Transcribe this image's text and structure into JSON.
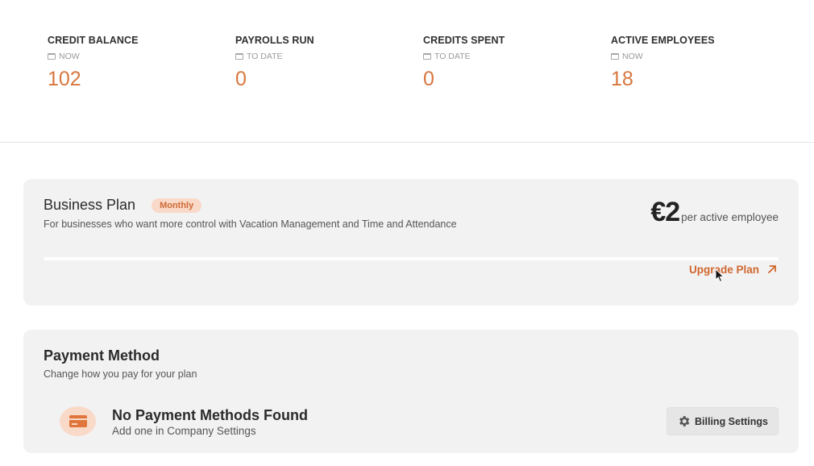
{
  "stats": [
    {
      "label": "CREDIT BALANCE",
      "sub": "NOW",
      "value": "102"
    },
    {
      "label": "PAYROLLS RUN",
      "sub": "TO DATE",
      "value": "0"
    },
    {
      "label": "CREDITS SPENT",
      "sub": "TO DATE",
      "value": "0"
    },
    {
      "label": "ACTIVE EMPLOYEES",
      "sub": "NOW",
      "value": "18"
    }
  ],
  "plan": {
    "title": "Business Plan",
    "badge": "Monthly",
    "description": "For businesses who want more control with Vacation Management and Time and Attendance",
    "price": "€2",
    "price_unit": "per active employee",
    "upgrade_label": "Upgrade Plan"
  },
  "payment": {
    "title": "Payment Method",
    "description": "Change how you pay for your plan",
    "empty_title": "No Payment Methods Found",
    "empty_subtitle": "Add one in Company Settings",
    "billing_button": "Billing Settings"
  },
  "colors": {
    "accent": "#d7773f",
    "badge_bg": "#f9d9c8",
    "card_bg": "#f2f2f2"
  },
  "icons": {
    "calendar": "calendar-icon",
    "upgrade": "arrow-up-right-icon",
    "card": "credit-card-icon",
    "billing": "gear-icon"
  }
}
